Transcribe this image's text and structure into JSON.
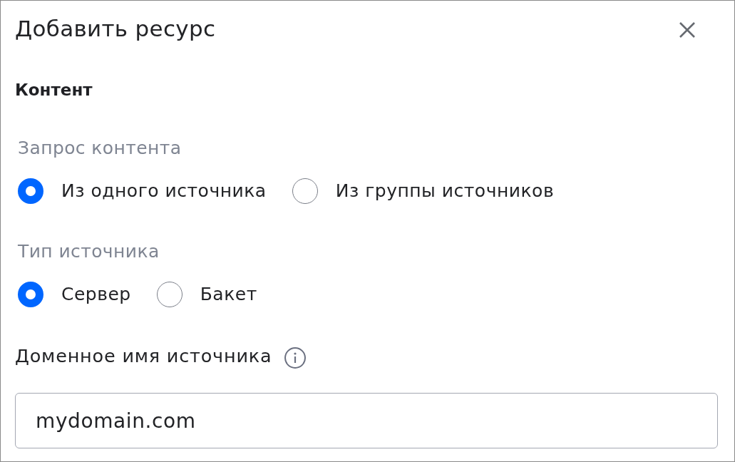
{
  "dialog": {
    "title": "Добавить ресурс"
  },
  "section_title": "Контент",
  "groups": [
    {
      "label": "Запрос контента",
      "options": [
        {
          "label": "Из одного источника",
          "selected": true
        },
        {
          "label": "Из группы источников",
          "selected": false
        }
      ]
    },
    {
      "label": "Тип источника",
      "options": [
        {
          "label": "Сервер",
          "selected": true
        },
        {
          "label": "Бакет",
          "selected": false
        }
      ]
    }
  ],
  "domain_field": {
    "label": "Доменное имя источника",
    "value": "mydomain.com"
  }
}
